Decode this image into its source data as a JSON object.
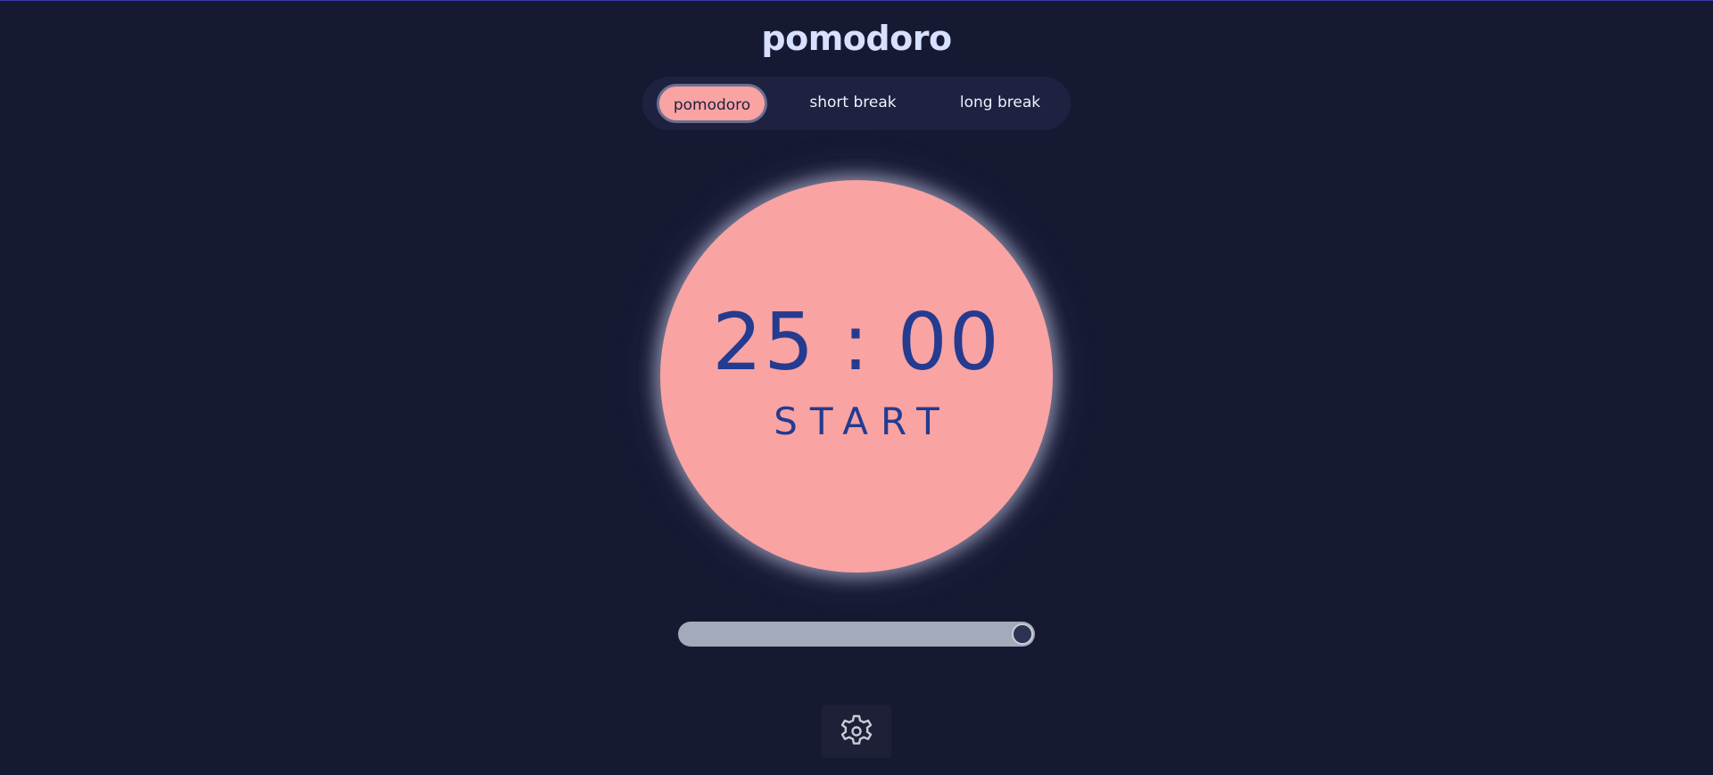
{
  "app": {
    "title": "pomodoro"
  },
  "modes": {
    "items": [
      {
        "label": "pomodoro",
        "active": true
      },
      {
        "label": "short break",
        "active": false
      },
      {
        "label": "long break",
        "active": false
      }
    ]
  },
  "timer": {
    "time": "25 : 00",
    "action_label": "START"
  },
  "progress": {
    "value_fraction": 1.0
  },
  "settings": {
    "icon": "gear-icon"
  },
  "colors": {
    "background": "#161932",
    "accent": "#f9a3a3",
    "timer_text": "#243b8f",
    "title_text": "#d7e0ff"
  }
}
